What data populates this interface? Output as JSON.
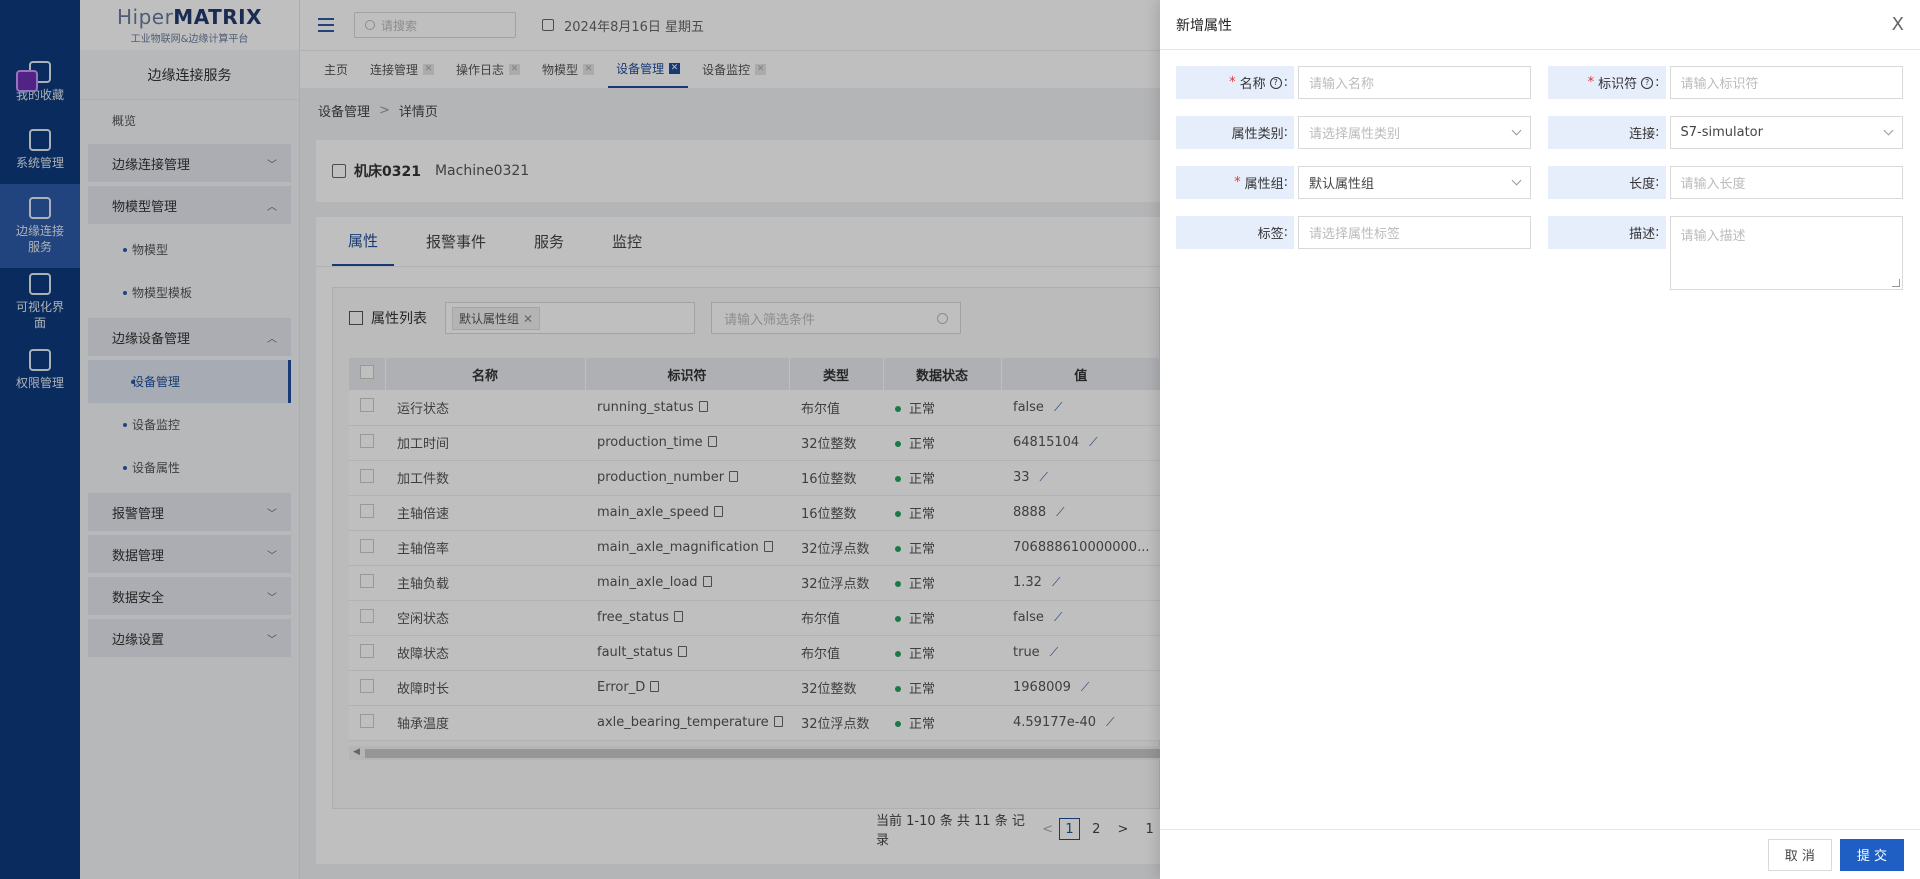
{
  "rail": {
    "items": [
      {
        "label": "我的收藏",
        "icon": "star-icon"
      },
      {
        "label": "系统管理",
        "icon": "cube-icon"
      },
      {
        "label": "边缘连接服务",
        "icon": "link-icon"
      },
      {
        "label": "可视化界面",
        "icon": "monitor-icon"
      },
      {
        "label": "权限管理",
        "icon": "shield-icon"
      }
    ]
  },
  "brand": {
    "name_prefix": "Hiper",
    "name_suffix": "MATRIX",
    "tagline": "工业物联网&边缘计算平台"
  },
  "sidebar": {
    "title": "边缘连接服务",
    "overview": "概览",
    "groups": [
      {
        "label": "边缘连接管理"
      },
      {
        "label": "物模型管理",
        "items": [
          "物模型",
          "物模型模板"
        ]
      },
      {
        "label": "边缘设备管理",
        "items": [
          "设备管理",
          "设备监控",
          "设备属性"
        ]
      },
      {
        "label": "报警管理"
      },
      {
        "label": "数据管理"
      },
      {
        "label": "数据安全"
      },
      {
        "label": "边缘设置"
      }
    ]
  },
  "header": {
    "search_placeholder": "请搜索",
    "date": "2024年8月16日 星期五"
  },
  "tabs": [
    "主页",
    "连接管理",
    "操作日志",
    "物模型",
    "设备管理",
    "设备监控"
  ],
  "breadcrumb": {
    "root": "设备管理",
    "sep": ">",
    "current": "详情页"
  },
  "device": {
    "name": "机床0321",
    "code": "Machine0321"
  },
  "panel_tabs": [
    "属性",
    "报警事件",
    "服务",
    "监控"
  ],
  "list": {
    "title": "属性列表",
    "group_chip": "默认属性组",
    "filter_placeholder": "请输入筛选条件",
    "columns": [
      "名称",
      "标识符",
      "类型",
      "数据状态",
      "值"
    ],
    "rows": [
      {
        "name": "运行状态",
        "id": "running_status",
        "type": "布尔值",
        "status": "正常",
        "value": "false"
      },
      {
        "name": "加工时间",
        "id": "production_time",
        "type": "32位整数",
        "status": "正常",
        "value": "64815104"
      },
      {
        "name": "加工件数",
        "id": "production_number",
        "type": "16位整数",
        "status": "正常",
        "value": "33"
      },
      {
        "name": "主轴倍速",
        "id": "main_axle_speed",
        "type": "16位整数",
        "status": "正常",
        "value": "8888"
      },
      {
        "name": "主轴倍率",
        "id": "main_axle_magnification",
        "type": "32位浮点数",
        "status": "正常",
        "value": "706888610000000..."
      },
      {
        "name": "主轴负载",
        "id": "main_axle_load",
        "type": "32位浮点数",
        "status": "正常",
        "value": "1.32"
      },
      {
        "name": "空闲状态",
        "id": "free_status",
        "type": "布尔值",
        "status": "正常",
        "value": "false"
      },
      {
        "name": "故障状态",
        "id": "fault_status",
        "type": "布尔值",
        "status": "正常",
        "value": "true"
      },
      {
        "name": "故障时长",
        "id": "Error_D",
        "type": "32位整数",
        "status": "正常",
        "value": "1968009"
      },
      {
        "name": "轴承温度",
        "id": "axle_bearing_temperature",
        "type": "32位浮点数",
        "status": "正常",
        "value": "4.59177e-40"
      }
    ],
    "pager": {
      "summary": "当前 1-10 条 共 11 条 记录",
      "prev": "<",
      "pages": [
        "1",
        "2"
      ],
      "next": ">",
      "last": "1"
    }
  },
  "drawer": {
    "title": "新增属性",
    "close": "X",
    "fields": {
      "name": {
        "label": "名称",
        "placeholder": "请输入名称"
      },
      "identifier": {
        "label": "标识符",
        "placeholder": "请输入标识符"
      },
      "category": {
        "label": "属性类别",
        "placeholder": "请选择属性类别"
      },
      "connection": {
        "label": "连接",
        "value": "S7-simulator"
      },
      "group": {
        "label": "属性组",
        "value": "默认属性组"
      },
      "length": {
        "label": "长度",
        "placeholder": "请输入长度"
      },
      "tags": {
        "label": "标签",
        "placeholder": "请选择属性标签"
      },
      "description": {
        "label": "描述",
        "placeholder": "请输入描述"
      }
    },
    "cancel": "取 消",
    "submit": "提 交"
  }
}
